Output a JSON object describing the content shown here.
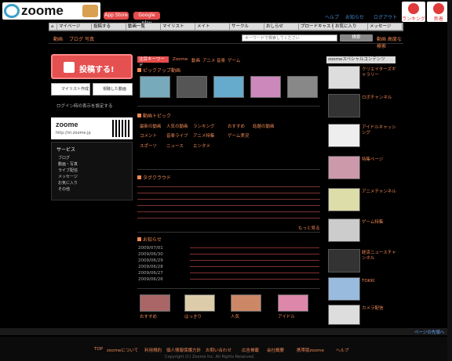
{
  "app": {
    "logo": "zoome",
    "pill1": "App Store",
    "pill2": "Google play"
  },
  "header_links": [
    "ヘルプ",
    "お知らせ",
    "ログアウト"
  ],
  "ranking": "ランキング",
  "new": "新着",
  "nav": [
    "マイページ",
    "投稿する",
    "動画一覧",
    "マイリスト",
    "メイト",
    "サークル",
    "おしらせ",
    "ブロードキャスト",
    "お気に入り",
    "メッセージ"
  ],
  "subnav": [
    "動画",
    "ブログ",
    "写真"
  ],
  "search": {
    "placeholder": "キーワードで検索してください",
    "button": "検索",
    "links": "動画 高度な検索"
  },
  "left": {
    "post": "投稿する!",
    "mylist": "マイリスト作成",
    "history": "視聴した動画",
    "login": "ログイン時の表示を設定する",
    "qr_text": "http://m.zoome.jp",
    "services_title": "サービス",
    "services": [
      "ブログ",
      "動画・写真",
      "ライブ配信",
      "メッセージ",
      "お気に入り",
      "その他"
    ]
  },
  "center": {
    "keywords_label": "注目キーワード",
    "keywords": [
      "Zoome",
      "動画",
      "アニメ",
      "音楽",
      "ゲーム"
    ],
    "pickup_label": "ピックアップ動画",
    "topics_label": "動画トピック",
    "topics": [
      "最新の動画",
      "人気の動画",
      "ランキング",
      "おすすめ",
      "話題の動画",
      "コメント",
      "音楽ライブ",
      "アニメ特集",
      "ゲーム実況",
      "スポーツ",
      "ニュース",
      "エンタメ"
    ],
    "tag_label": "タグクラウド",
    "more": "もっと見る",
    "news_label": "お知らせ",
    "news_rows": [
      "2009/07/01",
      "2009/06/30",
      "2009/06/29",
      "2009/06/28",
      "2009/06/27",
      "2009/06/26"
    ],
    "bottom_labels": [
      "おすすめ",
      "はっきり",
      "人気",
      "アイドル"
    ]
  },
  "right": {
    "header": "zoomeスペシャルコンテンツ",
    "items": [
      "クリエイターズギャラリー",
      "ロボチャンネル",
      "アイドルキャッシング",
      "特集ページ",
      "アニメチャンネル",
      "ゲーム特集",
      "経済ニュースチャンネル",
      "TOKKI",
      "カメラ配信"
    ]
  },
  "footer": [
    "TOP",
    "zoomeについて",
    "利用規約",
    "個人情報保護方針",
    "お問い合わせ",
    "広告掲載",
    "会社概要",
    "携帯版zoome",
    "ヘルプ"
  ],
  "copyright": "Copyright (C) Zoome Inc. All Rights Reserved.",
  "page_top": "ページの先頭へ",
  "accent": "#e85a3a"
}
